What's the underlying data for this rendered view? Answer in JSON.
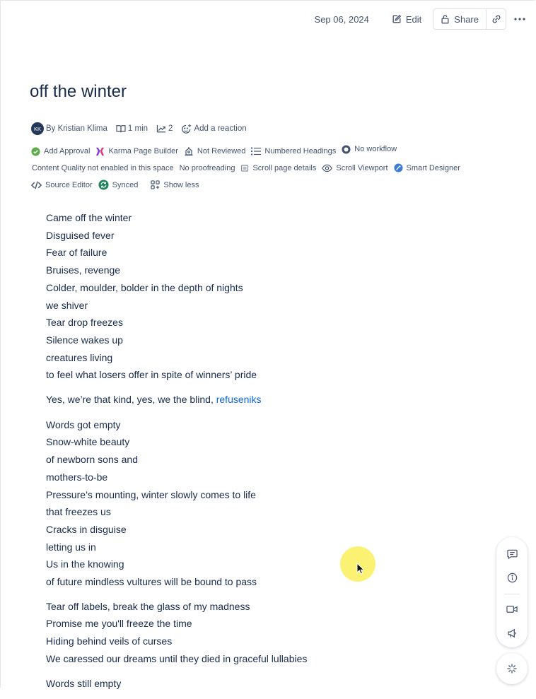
{
  "header": {
    "date": "Sep 06, 2024",
    "edit_label": "Edit",
    "share_label": "Share",
    "icons": {
      "edit": "pencil-icon",
      "share": "lock-icon",
      "link": "link-icon",
      "more": "more-icon"
    }
  },
  "page": {
    "title": "off the winter",
    "byline": {
      "initials": "KK",
      "author": "By Kristian Klima",
      "read_time": "1 min",
      "views": "2",
      "reaction": "Add a reaction"
    }
  },
  "apps": {
    "row1": [
      "Add Approval",
      "Karma Page Builder",
      "Not Reviewed",
      "Numbered Headings",
      "No workflow"
    ],
    "row2": [
      "Content Quality not enabled in this space",
      "No proofreading",
      "Scroll page details",
      "Scroll Viewport",
      "Smart Designer"
    ],
    "row3": [
      "Source Editor",
      "Synced",
      "Show less"
    ]
  },
  "content": {
    "stanza1": [
      "Came off the winter",
      "Disguised fever",
      "Fear of failure",
      "Bruises, revenge",
      "Colder, moulder, bolder in the depth of nights",
      "we shiver",
      "Tear drop freezes",
      "Silence wakes up",
      "creatures living",
      "to feel what losers offer in spite of winners’ pride"
    ],
    "stanza2_text": "Yes, we’re that kind, yes, we the blind, ",
    "stanza2_link": "refuseniks",
    "stanza3": [
      "Words got empty",
      "Snow-white beauty",
      "of newborn sons and",
      "mothers-to-be",
      "Pressure’s mounting, winter slowly comes to life",
      "that freezes us",
      "Cracks in disguise",
      "letting us in",
      "Us in the knowing",
      "of future mindless vultures will be bound to pass"
    ],
    "stanza4": [
      "Tear off labels, break the glass of my madness",
      "Promise me you'll freeze the time",
      "Hiding behind veils of curses",
      "We caressed our dreams until they died in graceful lullabies"
    ],
    "stanza5": [
      "Words still empty"
    ]
  },
  "floating_panel": [
    "comment-icon",
    "info-icon",
    "video-icon",
    "megaphone-icon"
  ],
  "ai_button": "sparkle-icon",
  "colors": {
    "link": "#0c66e4",
    "text": "#172b4d",
    "subtle": "#44546f",
    "cursor_highlight": "#f7ee5a"
  }
}
